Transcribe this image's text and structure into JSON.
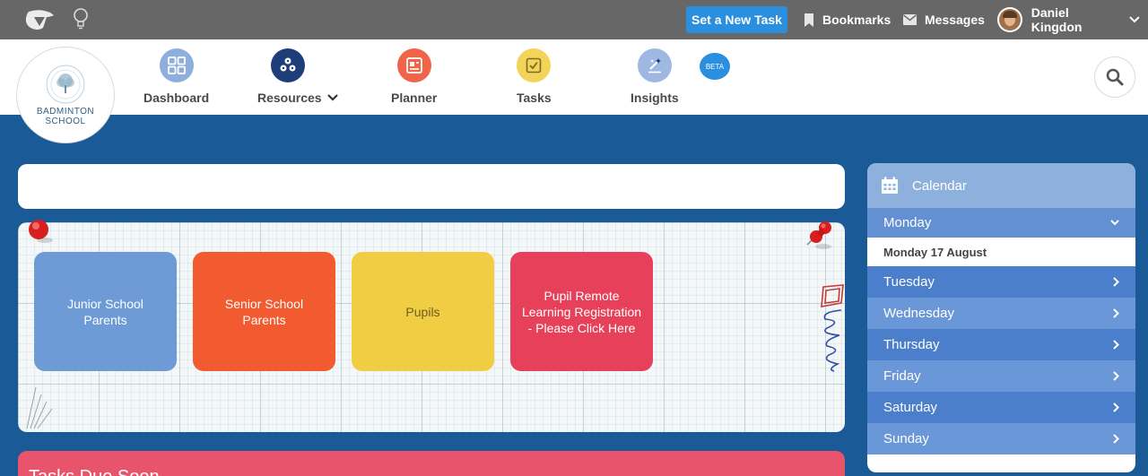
{
  "topbar": {
    "task_button": "Set a New Task",
    "bookmarks": "Bookmarks",
    "messages": "Messages",
    "user_name": "Daniel Kingdon"
  },
  "school": {
    "name_line1": "BADMINTON",
    "name_line2": "SCHOOL"
  },
  "nav": {
    "dashboard": "Dashboard",
    "resources": "Resources",
    "planner": "Planner",
    "tasks": "Tasks",
    "insights": "Insights",
    "beta": "BETA"
  },
  "tiles": [
    {
      "label": "Junior School Parents"
    },
    {
      "label": "Senior School Parents"
    },
    {
      "label": "Pupils"
    },
    {
      "label": "Pupil Remote Learning Registration - Please Click Here"
    }
  ],
  "tasks_panel": {
    "title": "Tasks Due Soon"
  },
  "calendar": {
    "title": "Calendar",
    "active_day": "Monday",
    "active_date": "Monday 17 August",
    "days": [
      "Tuesday",
      "Wednesday",
      "Thursday",
      "Friday",
      "Saturday",
      "Sunday"
    ]
  },
  "colors": {
    "topbar": "#676767",
    "accent_blue": "#2b8fe0",
    "page_blue": "#1a5a96",
    "dashboard": "#8eaede",
    "resources": "#1e3e7a",
    "planner": "#f0654a",
    "tasks": "#f3d458",
    "insights": "#9fb8e2"
  }
}
